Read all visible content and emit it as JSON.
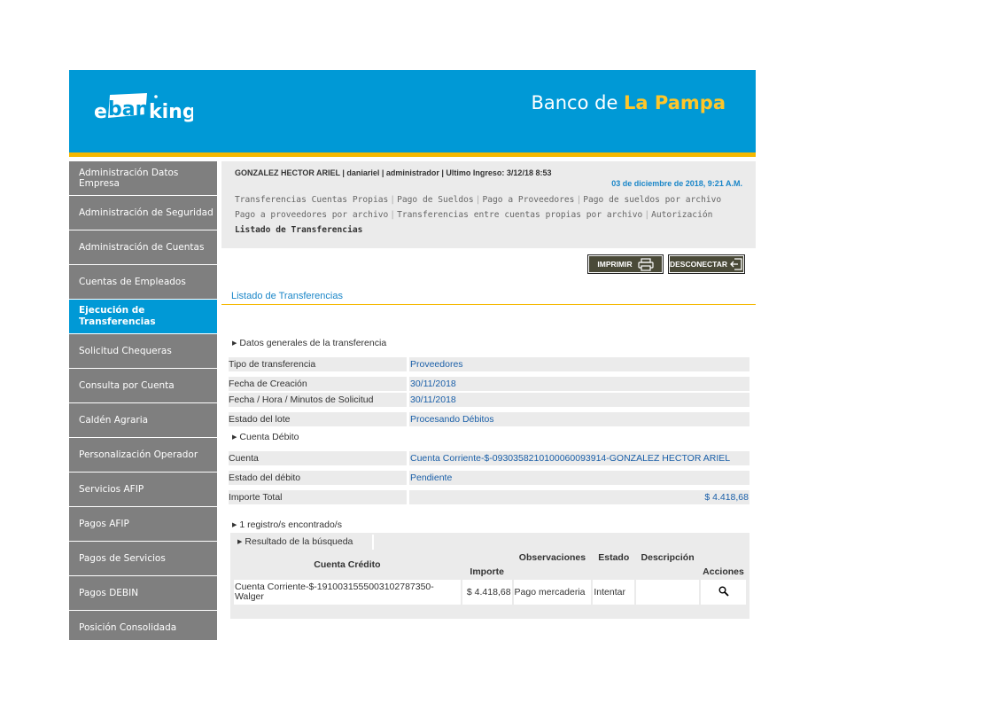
{
  "header": {
    "logo_text": "ebanking",
    "bank_name_prefix": "Banco de ",
    "bank_name_highlight": "La Pampa"
  },
  "sidebar": {
    "items": [
      {
        "label": "Administración Datos Empresa"
      },
      {
        "label": "Administración de Seguridad"
      },
      {
        "label": "Administración de Cuentas"
      },
      {
        "label": "Cuentas de Empleados"
      },
      {
        "label": "Ejecución de Transferencias",
        "active": true
      },
      {
        "label": "Solicitud Chequeras"
      },
      {
        "label": "Consulta por Cuenta"
      },
      {
        "label": "Caldén Agraria"
      },
      {
        "label": "Personalización Operador"
      },
      {
        "label": "Servicios AFIP"
      },
      {
        "label": "Pagos AFIP"
      },
      {
        "label": "Pagos de Servicios"
      },
      {
        "label": "Pagos DEBIN"
      },
      {
        "label": "Posición Consolidada"
      }
    ]
  },
  "userbar": {
    "user_info": "GONZALEZ HECTOR ARIEL | daniariel | administrador | Ultimo Ingreso: 3/12/18 8:53",
    "datetime": "03 de diciembre de 2018, 9:21 A.M."
  },
  "nav": {
    "links": [
      "Transferencias Cuentas Propias",
      "Pago de Sueldos",
      "Pago a Proveedores",
      "Pago de sueldos por archivo",
      "Pago a proveedores por archivo",
      "Transferencias entre cuentas propias por archivo",
      "Autorización"
    ],
    "current": "Listado de Transferencias"
  },
  "buttons": {
    "print": "IMPRIMIR",
    "disconnect": "DESCONECTAR"
  },
  "section_title": "Listado de Transferencias",
  "general": {
    "heading": "Datos generales de la transferencia",
    "rows": [
      {
        "label": "Tipo de transferencia",
        "value": "Proveedores"
      },
      {
        "label": "Fecha de Creación",
        "value": "30/11/2018"
      },
      {
        "label": "Fecha / Hora / Minutos de Solicitud",
        "value": "30/11/2018"
      },
      {
        "label": "Estado del lote",
        "value": "Procesando Débitos"
      }
    ]
  },
  "debit": {
    "heading": "Cuenta Débito",
    "rows": [
      {
        "label": "Cuenta",
        "value": "Cuenta Corriente-$-0930358210100060093914-GONZALEZ HECTOR ARIEL"
      },
      {
        "label": "Estado del débito",
        "value": "Pendiente"
      },
      {
        "label": "Importe Total",
        "value": "$ 4.418,68"
      }
    ]
  },
  "results": {
    "count_text": "1 registro/s encontrado/s",
    "heading": "Resultado de la búsqueda",
    "columns": [
      "Cuenta Crédito",
      "Importe",
      "Observaciones",
      "Estado",
      "Descripción",
      "Acciones"
    ],
    "rows": [
      {
        "account": "Cuenta Corriente-$-1910031555003102787350-Walger",
        "amount": "$ 4.418,68",
        "notes": "Pago mercaderia",
        "status": "Intentar",
        "description": ""
      }
    ]
  },
  "icons": {
    "print": "printer-icon",
    "disconnect": "logout-icon",
    "action": "magnifier-icon"
  }
}
